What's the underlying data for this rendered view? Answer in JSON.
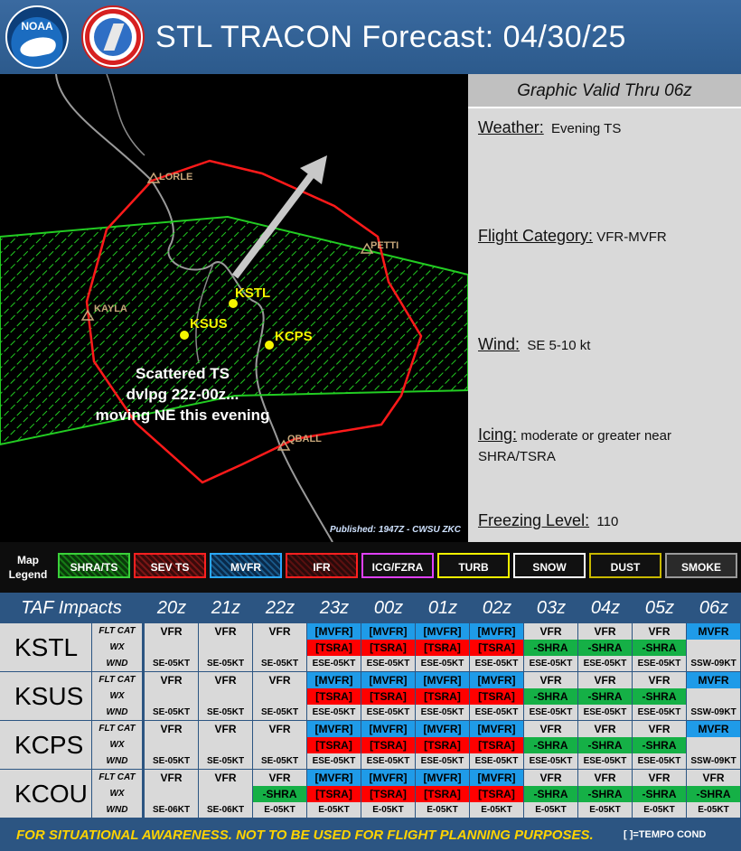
{
  "header": {
    "title": "STL TRACON Forecast: 04/30/25",
    "logo_noaa": "NOAA"
  },
  "map": {
    "airports": [
      {
        "id": "KSTL"
      },
      {
        "id": "KSUS"
      },
      {
        "id": "KCPS"
      }
    ],
    "waypoints": [
      "LORLE",
      "PETTI",
      "KAYLA",
      "QBALL"
    ],
    "caption": [
      "Scattered TS",
      "dvlpg 22z-00z...",
      "moving NE this evening"
    ],
    "published": "Published: 1947Z - CWSU ZKC",
    "colors": {
      "polygon": "#ff1a1a",
      "shra_area": "#22cc22",
      "arrow": "#c8c8c8",
      "airport": "#f5f500"
    }
  },
  "info": {
    "valid": "Graphic Valid Thru 06z",
    "weather_key": "Weather:",
    "weather_val": "Evening TS",
    "flight_key": "Flight Category:",
    "flight_val": "VFR-MVFR",
    "wind_key": "Wind:",
    "wind_val": "SE 5-10 kt",
    "icing_key": "Icing:",
    "icing_val": "moderate or greater near SHRA/TSRA",
    "freezing_key": "Freezing Level:",
    "freezing_val": "110"
  },
  "legend": {
    "title_line1": "Map",
    "title_line2": "Legend",
    "items": [
      "SHRA/TS",
      "SEV TS",
      "MVFR",
      "IFR",
      "ICG/FZRA",
      "TURB",
      "SNOW",
      "DUST",
      "SMOKE"
    ]
  },
  "taf": {
    "title": "TAF Impacts",
    "hours": [
      "20z",
      "21z",
      "22z",
      "23z",
      "00z",
      "01z",
      "02z",
      "03z",
      "04z",
      "05z",
      "06z"
    ],
    "row_labels": [
      "FLT CAT",
      "WX",
      "WND"
    ],
    "stations": [
      {
        "id": "KSTL",
        "flt": [
          "VFR",
          "VFR",
          "VFR",
          "[MVFR]",
          "[MVFR]",
          "[MVFR]",
          "[MVFR]",
          "VFR",
          "VFR",
          "VFR",
          "MVFR"
        ],
        "wx": [
          "",
          "",
          "",
          "[TSRA]",
          "[TSRA]",
          "[TSRA]",
          "[TSRA]",
          "-SHRA",
          "-SHRA",
          "-SHRA",
          ""
        ],
        "wnd": [
          "SE-05KT",
          "SE-05KT",
          "SE-05KT",
          "ESE-05KT",
          "ESE-05KT",
          "ESE-05KT",
          "ESE-05KT",
          "ESE-05KT",
          "ESE-05KT",
          "ESE-05KT",
          "SSW-09KT"
        ]
      },
      {
        "id": "KSUS",
        "flt": [
          "VFR",
          "VFR",
          "VFR",
          "[MVFR]",
          "[MVFR]",
          "[MVFR]",
          "[MVFR]",
          "VFR",
          "VFR",
          "VFR",
          "MVFR"
        ],
        "wx": [
          "",
          "",
          "",
          "[TSRA]",
          "[TSRA]",
          "[TSRA]",
          "[TSRA]",
          "-SHRA",
          "-SHRA",
          "-SHRA",
          ""
        ],
        "wnd": [
          "SE-05KT",
          "SE-05KT",
          "SE-05KT",
          "ESE-05KT",
          "ESE-05KT",
          "ESE-05KT",
          "ESE-05KT",
          "ESE-05KT",
          "ESE-05KT",
          "ESE-05KT",
          "SSW-09KT"
        ]
      },
      {
        "id": "KCPS",
        "flt": [
          "VFR",
          "VFR",
          "VFR",
          "[MVFR]",
          "[MVFR]",
          "[MVFR]",
          "[MVFR]",
          "VFR",
          "VFR",
          "VFR",
          "MVFR"
        ],
        "wx": [
          "",
          "",
          "",
          "[TSRA]",
          "[TSRA]",
          "[TSRA]",
          "[TSRA]",
          "-SHRA",
          "-SHRA",
          "-SHRA",
          ""
        ],
        "wnd": [
          "SE-05KT",
          "SE-05KT",
          "SE-05KT",
          "ESE-05KT",
          "ESE-05KT",
          "ESE-05KT",
          "ESE-05KT",
          "ESE-05KT",
          "ESE-05KT",
          "ESE-05KT",
          "SSW-09KT"
        ]
      },
      {
        "id": "KCOU",
        "flt": [
          "VFR",
          "VFR",
          "VFR",
          "[MVFR]",
          "[MVFR]",
          "[MVFR]",
          "[MVFR]",
          "VFR",
          "VFR",
          "VFR",
          "VFR"
        ],
        "wx": [
          "",
          "",
          "-SHRA",
          "[TSRA]",
          "[TSRA]",
          "[TSRA]",
          "[TSRA]",
          "-SHRA",
          "-SHRA",
          "-SHRA",
          "-SHRA"
        ],
        "wnd": [
          "SE-06KT",
          "SE-06KT",
          "E-05KT",
          "E-05KT",
          "E-05KT",
          "E-05KT",
          "E-05KT",
          "E-05KT",
          "E-05KT",
          "E-05KT",
          "E-05KT"
        ]
      }
    ]
  },
  "footer": {
    "disclaimer": "FOR SITUATIONAL AWARENESS. NOT TO BE USED FOR FLIGHT PLANNING PURPOSES.",
    "tempo": "[ ]=TEMPO  COND"
  }
}
